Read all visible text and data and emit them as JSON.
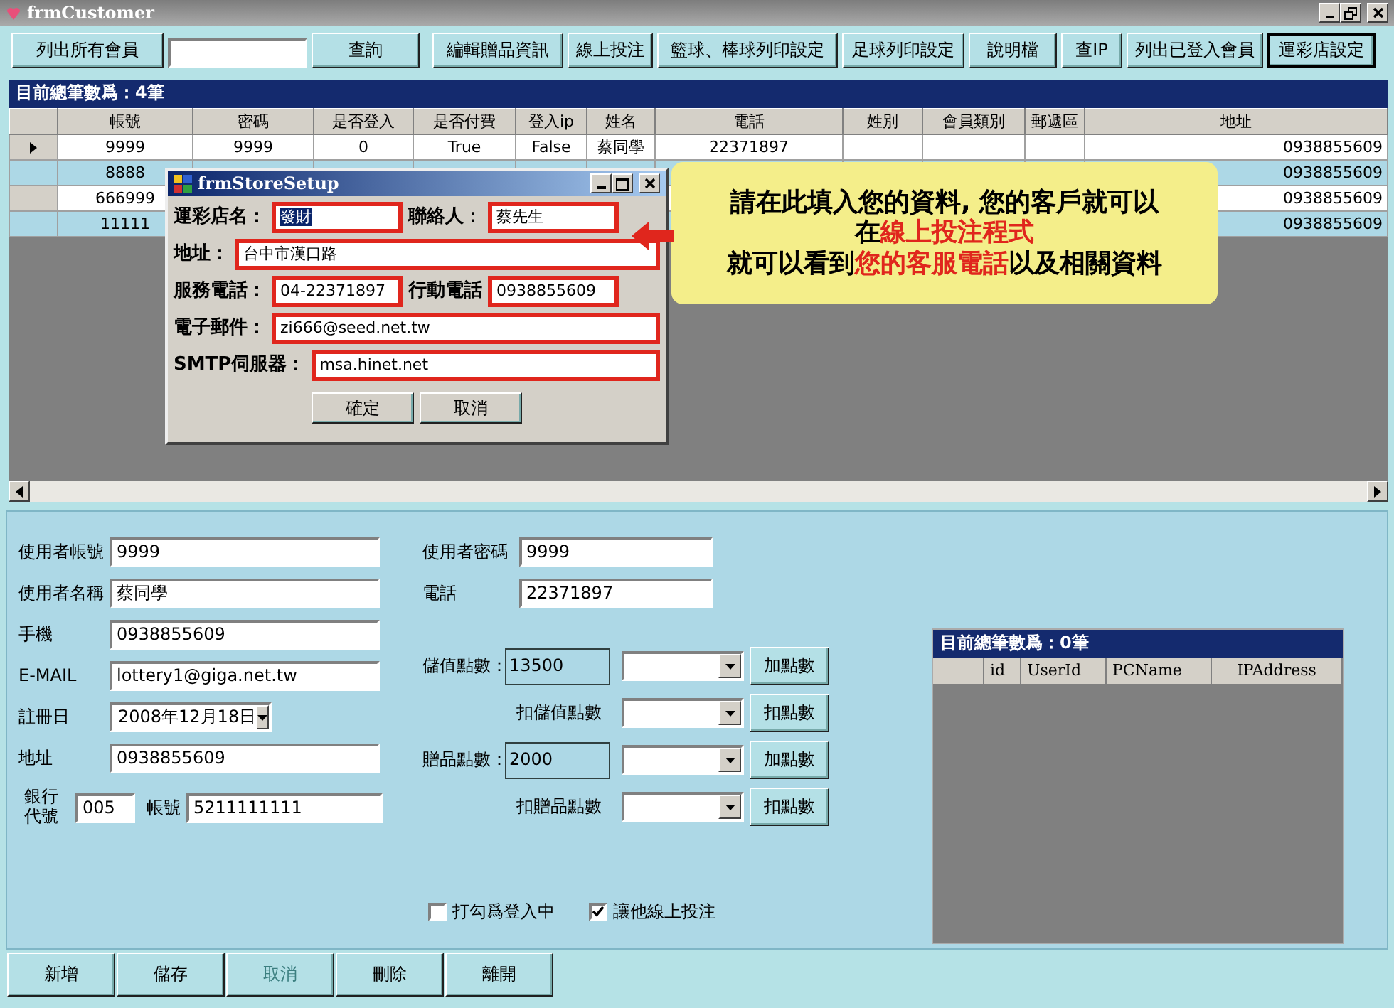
{
  "window": {
    "title": "frmCustomer"
  },
  "toolbar": [
    {
      "kind": "button",
      "label": "列出所有會員",
      "focused": false
    },
    {
      "kind": "field"
    },
    {
      "kind": "button",
      "label": "查詢",
      "focused": false
    },
    {
      "kind": "button",
      "label": "編輯贈品資訊",
      "focused": false
    },
    {
      "kind": "button",
      "label": "線上投注",
      "focused": false
    },
    {
      "kind": "button",
      "label": "籃球、棒球列印設定",
      "focused": false
    },
    {
      "kind": "button",
      "label": "足球列印設定",
      "focused": false
    },
    {
      "kind": "button",
      "label": "說明檔",
      "focused": false
    },
    {
      "kind": "button",
      "label": "查IP",
      "focused": false
    },
    {
      "kind": "button",
      "label": "列出已登入會員",
      "focused": false
    },
    {
      "kind": "button",
      "label": "運彩店設定",
      "focused": true
    }
  ],
  "members": {
    "title": "目前總筆數爲：4筆",
    "columns": [
      "帳號",
      "密碼",
      "是否登入",
      "是否付費",
      "登入ip",
      "姓名",
      "電話",
      "姓別",
      "會員類別",
      "郵遞區",
      "地址"
    ],
    "rows": [
      {
        "selected": true,
        "account": "9999",
        "password": "9999",
        "logged_in": "0",
        "paid": "True",
        "login_ip": "False",
        "name": "蔡同學",
        "phone": "22371897",
        "address": "0938855609"
      },
      {
        "selected": false,
        "account": "8888",
        "address": "0938855609"
      },
      {
        "selected": false,
        "account": "666999",
        "address": "0938855609"
      },
      {
        "selected": false,
        "account": "11111",
        "address": "0938855609"
      }
    ]
  },
  "store_dialog": {
    "title": "frmStoreSetup",
    "fields": [
      {
        "kind": "half",
        "label": "運彩店名：",
        "value": "發財",
        "highlighted": true
      },
      {
        "kind": "half",
        "label": "聯絡人：",
        "value": "蔡先生",
        "highlighted": false
      },
      {
        "kind": "full",
        "label": "地址：",
        "value": "台中市漢口路",
        "highlighted": false
      },
      {
        "kind": "half",
        "label": "服務電話：",
        "value": "04-22371897",
        "highlighted": false
      },
      {
        "kind": "half",
        "label": "行動電話",
        "value": "0938855609",
        "highlighted": false
      },
      {
        "kind": "full",
        "label": "電子郵件：",
        "value": "zi666@seed.net.tw",
        "highlighted": false
      },
      {
        "kind": "full",
        "label": "SMTP伺服器：",
        "value": "msa.hinet.net",
        "highlighted": false
      }
    ],
    "buttons": [
      "確定",
      "取消"
    ]
  },
  "callout": {
    "lines": [
      [
        {
          "text": "請在此填入您的資料, 您的客戶就可以",
          "red": false
        }
      ],
      [
        {
          "text": "在",
          "red": false
        },
        {
          "text": "線上投注程式",
          "red": true
        }
      ],
      [
        {
          "text": "就可以看到",
          "red": false
        },
        {
          "text": "您的客服電話",
          "red": true
        },
        {
          "text": "以及相關資料",
          "red": false
        }
      ]
    ]
  },
  "member_form": {
    "left": [
      {
        "kind": "text",
        "label": "使用者帳號",
        "value": "9999"
      },
      {
        "kind": "text",
        "label": "使用者名稱",
        "value": "蔡同學"
      },
      {
        "kind": "text",
        "label": "手機",
        "value": "0938855609"
      },
      {
        "kind": "text",
        "label": "E-MAIL",
        "value": "lottery1@giga.net.tw"
      },
      {
        "kind": "date",
        "label": "註冊日",
        "value": "2008年12月18日"
      },
      {
        "kind": "text",
        "label": "地址",
        "value": "0938855609"
      },
      {
        "kind": "bank",
        "label": "銀行代號",
        "value": "005",
        "account_label": "帳號",
        "account_value": "5211111111"
      }
    ],
    "right": [
      {
        "label": "使用者密碼",
        "value": "9999"
      },
      {
        "label": "電話",
        "value": "22371897"
      }
    ],
    "points": [
      {
        "kind": "balance",
        "label": "儲值點數：",
        "value": "13500",
        "button": "加點數"
      },
      {
        "kind": "deduct",
        "label": "扣儲值點數",
        "button": "扣點數"
      },
      {
        "kind": "balance",
        "label": "贈品點數：",
        "value": "2000",
        "button": "加點數"
      },
      {
        "kind": "deduct",
        "label": "扣贈品點數",
        "button": "扣點數"
      }
    ],
    "checkboxes": [
      {
        "label": "打勾爲登入中",
        "checked": false
      },
      {
        "label": "讓他線上投注",
        "checked": true
      }
    ]
  },
  "logins": {
    "title": "目前總筆數爲：0筆",
    "columns": [
      "id",
      "UserId",
      "PCName",
      "IPAddress"
    ]
  },
  "bottom_buttons": [
    {
      "label": "新增",
      "disabled": false
    },
    {
      "label": "儲存",
      "disabled": false
    },
    {
      "label": "取消",
      "disabled": true
    },
    {
      "label": "刪除",
      "disabled": false
    },
    {
      "label": "離開",
      "disabled": false
    }
  ]
}
